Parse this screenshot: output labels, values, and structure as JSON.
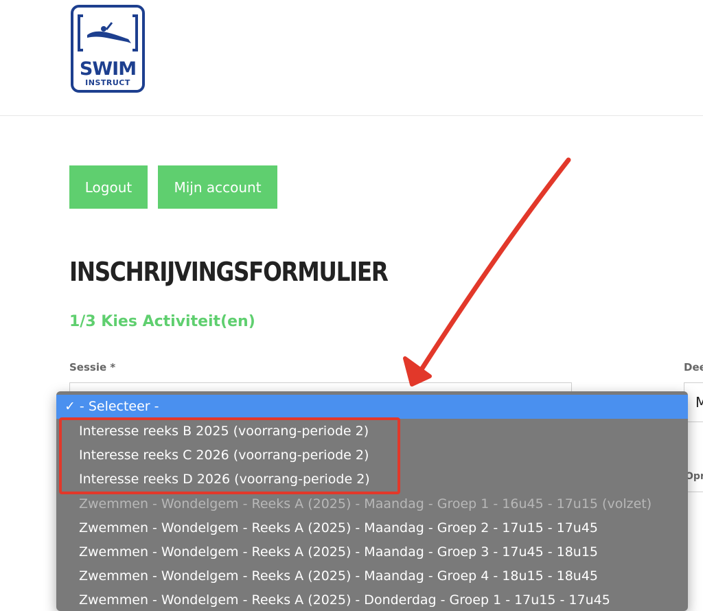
{
  "logo": {
    "word_main": "SWIM",
    "word_sub": "INSTRUCT"
  },
  "buttons": {
    "logout": "Logout",
    "account": "Mijn account"
  },
  "form": {
    "title": "INSCHRIJVINGSFORMULIER",
    "step": "1/3 Kies Activiteit(en)",
    "session_label": "Sessie *",
    "right_label": "Dee",
    "right_value": "M",
    "right_label_2": "Opr"
  },
  "dropdown": {
    "check": "✓",
    "selected": "- Selecteer -",
    "options": [
      "Interesse reeks B 2025 (voorrang-periode 2)",
      "Interesse reeks C 2026 (voorrang-periode 2)",
      "Interesse reeks D 2026 (voorrang-periode 2)",
      "Zwemmen - Wondelgem - Reeks A (2025) - Maandag - Groep 1 - 16u45 - 17u15 (volzet)",
      "Zwemmen - Wondelgem - Reeks A (2025) - Maandag - Groep 2 - 17u15 - 17u45",
      "Zwemmen - Wondelgem - Reeks A (2025) - Maandag - Groep 3 - 17u45 - 18u15",
      "Zwemmen - Wondelgem - Reeks A (2025) - Maandag - Groep 4 - 18u15 - 18u45",
      "Zwemmen - Wondelgem - Reeks A (2025) - Donderdag - Groep 1 - 17u15 - 17u45"
    ],
    "disabled_index": 3
  },
  "colors": {
    "brand_blue": "#1d3f8f",
    "button_green": "#5fcf6f",
    "dropdown_bg": "#7a7a7a",
    "selected_bg": "#4a90ef",
    "annotation_red": "#e2382a"
  }
}
